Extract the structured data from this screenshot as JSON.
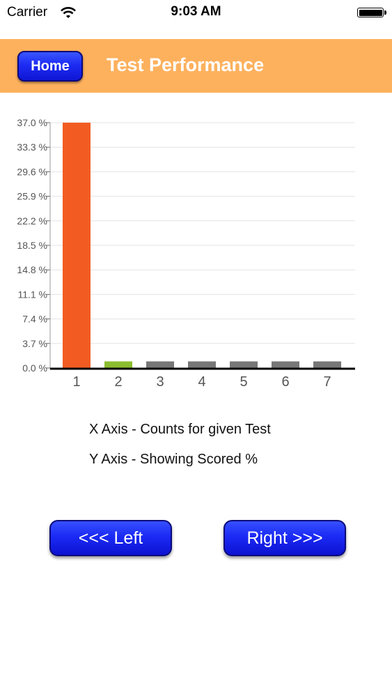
{
  "status_bar": {
    "carrier": "Carrier",
    "time": "9:03 AM"
  },
  "nav": {
    "home_label": "Home",
    "title": "Test Performance",
    "background_color": "#fdb15d"
  },
  "chart_data": {
    "type": "bar",
    "categories": [
      "1",
      "2",
      "3",
      "4",
      "5",
      "6",
      "7"
    ],
    "values": [
      37.0,
      1.0,
      1.0,
      1.0,
      1.0,
      1.0,
      1.0
    ],
    "bar_colors": [
      "#f25c22",
      "#8bbd2f",
      "#777777",
      "#777777",
      "#777777",
      "#777777",
      "#777777"
    ],
    "y_ticks": [
      "0.0 %",
      "3.7 %",
      "7.4 %",
      "11.1 %",
      "14.8 %",
      "18.5 %",
      "22.2 %",
      "25.9 %",
      "29.6 %",
      "33.3 %",
      "37.0 %"
    ],
    "ylim": [
      0,
      37.0
    ],
    "grid": true,
    "title": "",
    "xlabel": "",
    "ylabel": ""
  },
  "captions": {
    "x_axis": "X Axis - Counts for given Test",
    "y_axis": "Y Axis - Showing Scored %"
  },
  "buttons": {
    "left_label": "<<< Left",
    "right_label": "Right >>>"
  }
}
